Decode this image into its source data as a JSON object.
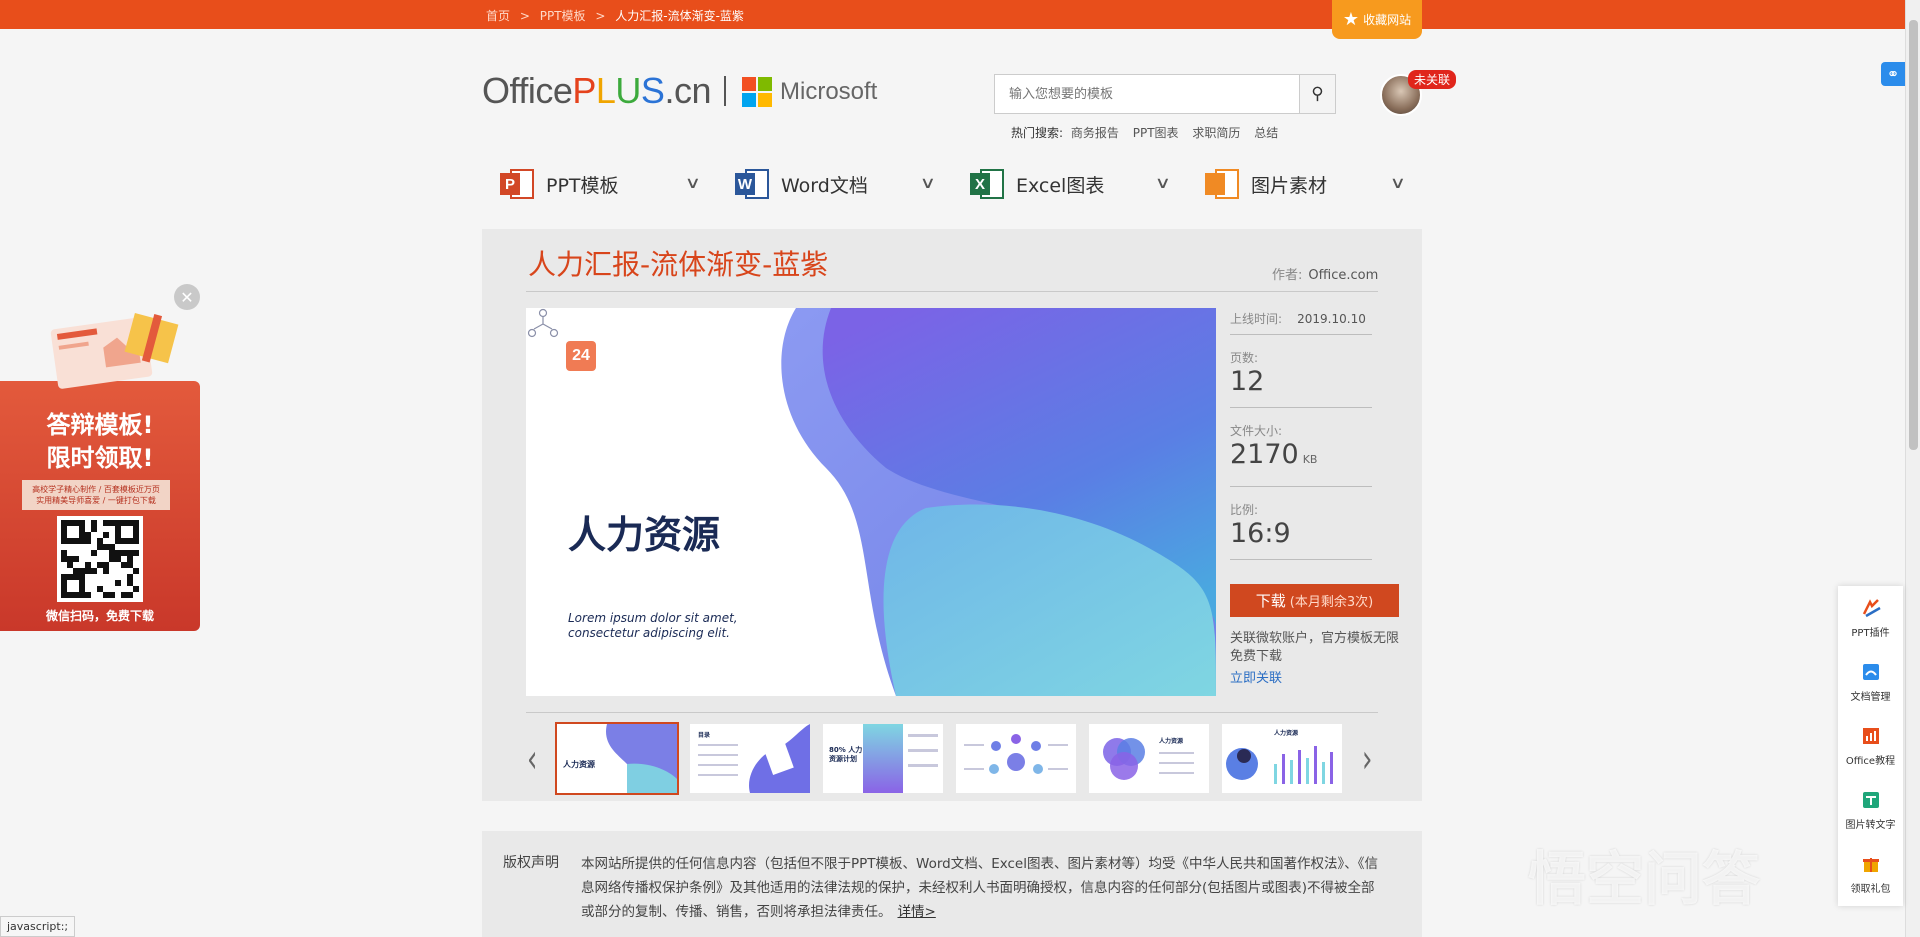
{
  "breadcrumb": {
    "home": "首页",
    "sep": ">",
    "category": "PPT模板",
    "current": "人力汇报-流体渐变-蓝紫"
  },
  "favorite": {
    "label": "收藏网站",
    "icon": "star-icon"
  },
  "logo": {
    "office": "Office",
    "p": "P",
    "l": "L",
    "u": "U",
    "s": "S",
    "cn": ".cn",
    "microsoft": "Microsoft"
  },
  "colors": {
    "accent": "#e84e1b",
    "title": "#d8451b",
    "download": "#d0481f",
    "link": "#2b6ec4",
    "ms_red": "#f25022",
    "ms_green": "#7fba00",
    "ms_blue": "#00a4ef",
    "ms_yellow": "#ffb900"
  },
  "search": {
    "placeholder": "输入您想要的模板",
    "icon": "search-icon"
  },
  "hot": {
    "label": "热门搜索:",
    "keywords": [
      "商务报告",
      "PPT图表",
      "求职简历",
      "总结"
    ]
  },
  "user": {
    "badge": "未关联"
  },
  "nav": [
    {
      "label": "PPT模板",
      "letter": "P",
      "color": "#d24726",
      "icon": "powerpoint-icon"
    },
    {
      "label": "Word文档",
      "letter": "W",
      "color": "#2b579a",
      "icon": "word-icon"
    },
    {
      "label": "Excel图表",
      "letter": "X",
      "color": "#217346",
      "icon": "excel-icon"
    },
    {
      "label": "图片素材",
      "letter": "",
      "color": "#f08a24",
      "icon": "image-icon"
    }
  ],
  "template": {
    "title": "人力汇报-流体渐变-蓝紫",
    "author_label": "作者:",
    "author": "Office.com",
    "preview": {
      "logo": "24",
      "title": "人力资源",
      "subtitle": "Lorem ipsum dolor sit amet, consectetur adipiscing elit."
    }
  },
  "meta": {
    "date_label": "上线时间:",
    "date": "2019.10.10",
    "pages_label": "页数:",
    "pages": "12",
    "size_label": "文件大小:",
    "size": "2170",
    "size_unit": "KB",
    "ratio_label": "比例:",
    "ratio": "16:9"
  },
  "download": {
    "label": "下载",
    "remaining": "(本月剩余3次)",
    "note": "关联微软账户，官方模板无限免费下载",
    "link": "立即关联"
  },
  "thumbnails": [
    {
      "title": "人力资源"
    },
    {
      "title": "目录"
    },
    {
      "title": "80% 人力资源计划"
    },
    {
      "title": ""
    },
    {
      "title": "人力资源"
    },
    {
      "title": "人力资源"
    }
  ],
  "copyright": {
    "label": "版权声明",
    "text": "本网站所提供的任何信息内容（包括但不限于PPT模板、Word文档、Excel图表、图片素材等）均受《中华人民共和国著作权法》、《信息网络传播权保护条例》及其他适用的法律法规的保护，未经权利人书面明确授权，信息内容的任何部分(包括图片或图表)不得被全部或部分的复制、传播、销售，否则将承担法律责任。",
    "more": "详情>"
  },
  "promo": {
    "title_line1": "答辩模板!",
    "title_line2": "限时领取!",
    "ribbon_line1": "高校学子精心制作 / 百套模板近万页",
    "ribbon_line2": "实用精美导师喜爱 / 一键打包下载",
    "footer": "微信扫码，免费下载"
  },
  "tools": [
    {
      "label": "PPT插件",
      "icon": "ppt-plugin-icon"
    },
    {
      "label": "文档管理",
      "icon": "document-manage-icon"
    },
    {
      "label": "Office教程",
      "icon": "office-tutorial-icon"
    },
    {
      "label": "图片转文字",
      "icon": "image-to-text-icon"
    },
    {
      "label": "领取礼包",
      "icon": "gift-icon"
    }
  ],
  "status": "javascript:;",
  "watermark": "悟空问答"
}
